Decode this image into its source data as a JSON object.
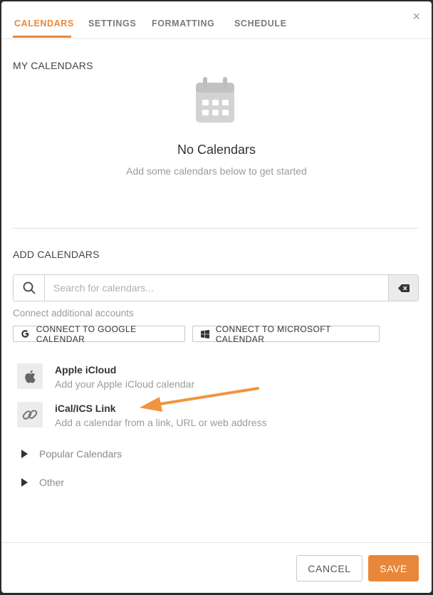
{
  "tabs": [
    {
      "label": "CALENDARS",
      "active": true
    },
    {
      "label": "SETTINGS",
      "active": false
    },
    {
      "label": "FORMATTING",
      "active": false
    },
    {
      "label": "SCHEDULE",
      "active": false
    }
  ],
  "close_glyph": "×",
  "my_calendars": {
    "title": "MY CALENDARS",
    "empty_title": "No Calendars",
    "empty_subtitle": "Add some calendars below to get started",
    "icon": "calendar-icon"
  },
  "add_calendars": {
    "title": "ADD CALENDARS",
    "search_placeholder": "Search for calendars...",
    "search_value": "",
    "connect_note": "Connect additional accounts",
    "connect_google": "CONNECT TO GOOGLE CALENDAR",
    "connect_microsoft": "CONNECT TO MICROSOFT CALENDAR",
    "providers": [
      {
        "name": "Apple iCloud",
        "description": "Add your Apple iCloud calendar",
        "icon": "apple-icon"
      },
      {
        "name": "iCal/ICS Link",
        "description": "Add a calendar from a link, URL or web address",
        "icon": "link-icon"
      }
    ],
    "expanders": [
      {
        "label": "Popular Calendars"
      },
      {
        "label": "Other"
      }
    ]
  },
  "footer": {
    "cancel_label": "CANCEL",
    "save_label": "SAVE"
  },
  "colors": {
    "accent": "#e8873a",
    "annotation_arrow": "#f0953f"
  }
}
